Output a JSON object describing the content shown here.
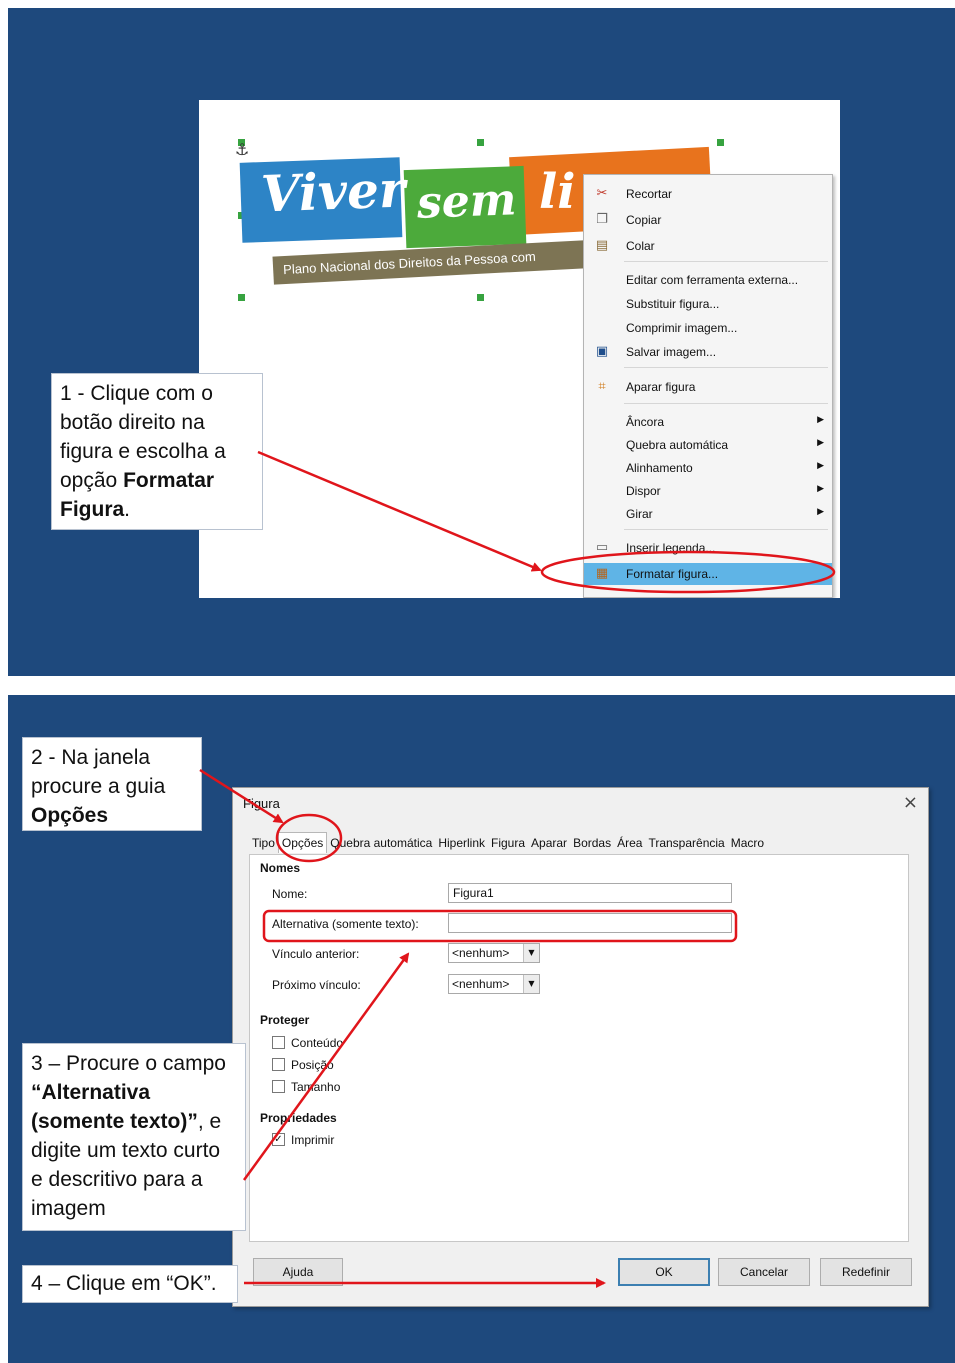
{
  "colors": {
    "panel_bg": "#1e497d",
    "annotation_red": "#e0151b",
    "menu_highlight": "#5fb4e6"
  },
  "step1": {
    "logo": {
      "word1": "Viver",
      "word2": "sem",
      "word3": "li",
      "strip_text": "Plano Nacional dos Direitos da Pessoa com"
    },
    "menu": {
      "items": [
        {
          "label": "Recortar",
          "icon": "scissors-icon"
        },
        {
          "label": "Copiar",
          "icon": "copy-icon"
        },
        {
          "label": "Colar",
          "icon": "paste-icon"
        },
        {
          "label": "Editar com ferramenta externa..."
        },
        {
          "label": "Substituir figura..."
        },
        {
          "label": "Comprimir imagem..."
        },
        {
          "label": "Salvar imagem...",
          "icon": "save-icon"
        },
        {
          "label": "Aparar figura",
          "icon": "crop-icon"
        },
        {
          "label": "Âncora",
          "submenu": true
        },
        {
          "label": "Quebra automática",
          "submenu": true
        },
        {
          "label": "Alinhamento",
          "submenu": true
        },
        {
          "label": "Dispor",
          "submenu": true
        },
        {
          "label": "Girar",
          "submenu": true
        },
        {
          "label": "Inserir legenda...",
          "icon": "caption-icon"
        },
        {
          "label": "Formatar figura...",
          "icon": "format-image-icon",
          "highlighted": true
        }
      ]
    },
    "callout": {
      "line1": "1 - Clique com o",
      "line2": "botão direito na",
      "line3": "figura e escolha a",
      "line4_pre": "opção ",
      "line4_bold": "Formatar",
      "line5_bold": "Figura",
      "line5_post": "."
    }
  },
  "step2": {
    "callout": {
      "line1": "2 - Na janela",
      "line2": "procure a guia",
      "line3_bold": "Opções"
    }
  },
  "step3": {
    "callout": {
      "line1": "3 – Procure o campo",
      "line2_bold": "“Alternativa",
      "line3_bold": "(somente texto)”",
      "line3_post": ", e",
      "line4": "digite um texto curto",
      "line5": "e descritivo para a",
      "line6": "imagem"
    }
  },
  "step4": {
    "callout": {
      "text": "4 – Clique em “OK”."
    }
  },
  "dialog": {
    "title": "Figura",
    "tabs": [
      "Tipo",
      "Opções",
      "Quebra automática",
      "Hiperlink",
      "Figura",
      "Aparar",
      "Bordas",
      "Área",
      "Transparência",
      "Macro"
    ],
    "active_tab": "Opções",
    "names_section": "Nomes",
    "name_label": "Nome:",
    "name_value": "Figura1",
    "alt_label": "Alternativa (somente texto):",
    "alt_value": "",
    "prev_link_label": "Vínculo anterior:",
    "prev_link_value": "<nenhum>",
    "next_link_label": "Próximo vínculo:",
    "next_link_value": "<nenhum>",
    "protect_section": "Proteger",
    "protect_content": "Conteúdo",
    "protect_position": "Posição",
    "protect_size": "Tamanho",
    "props_section": "Propriedades",
    "print_label": "Imprimir",
    "print_checked": true,
    "buttons": {
      "help": "Ajuda",
      "ok": "OK",
      "cancel": "Cancelar",
      "reset": "Redefinir"
    }
  }
}
